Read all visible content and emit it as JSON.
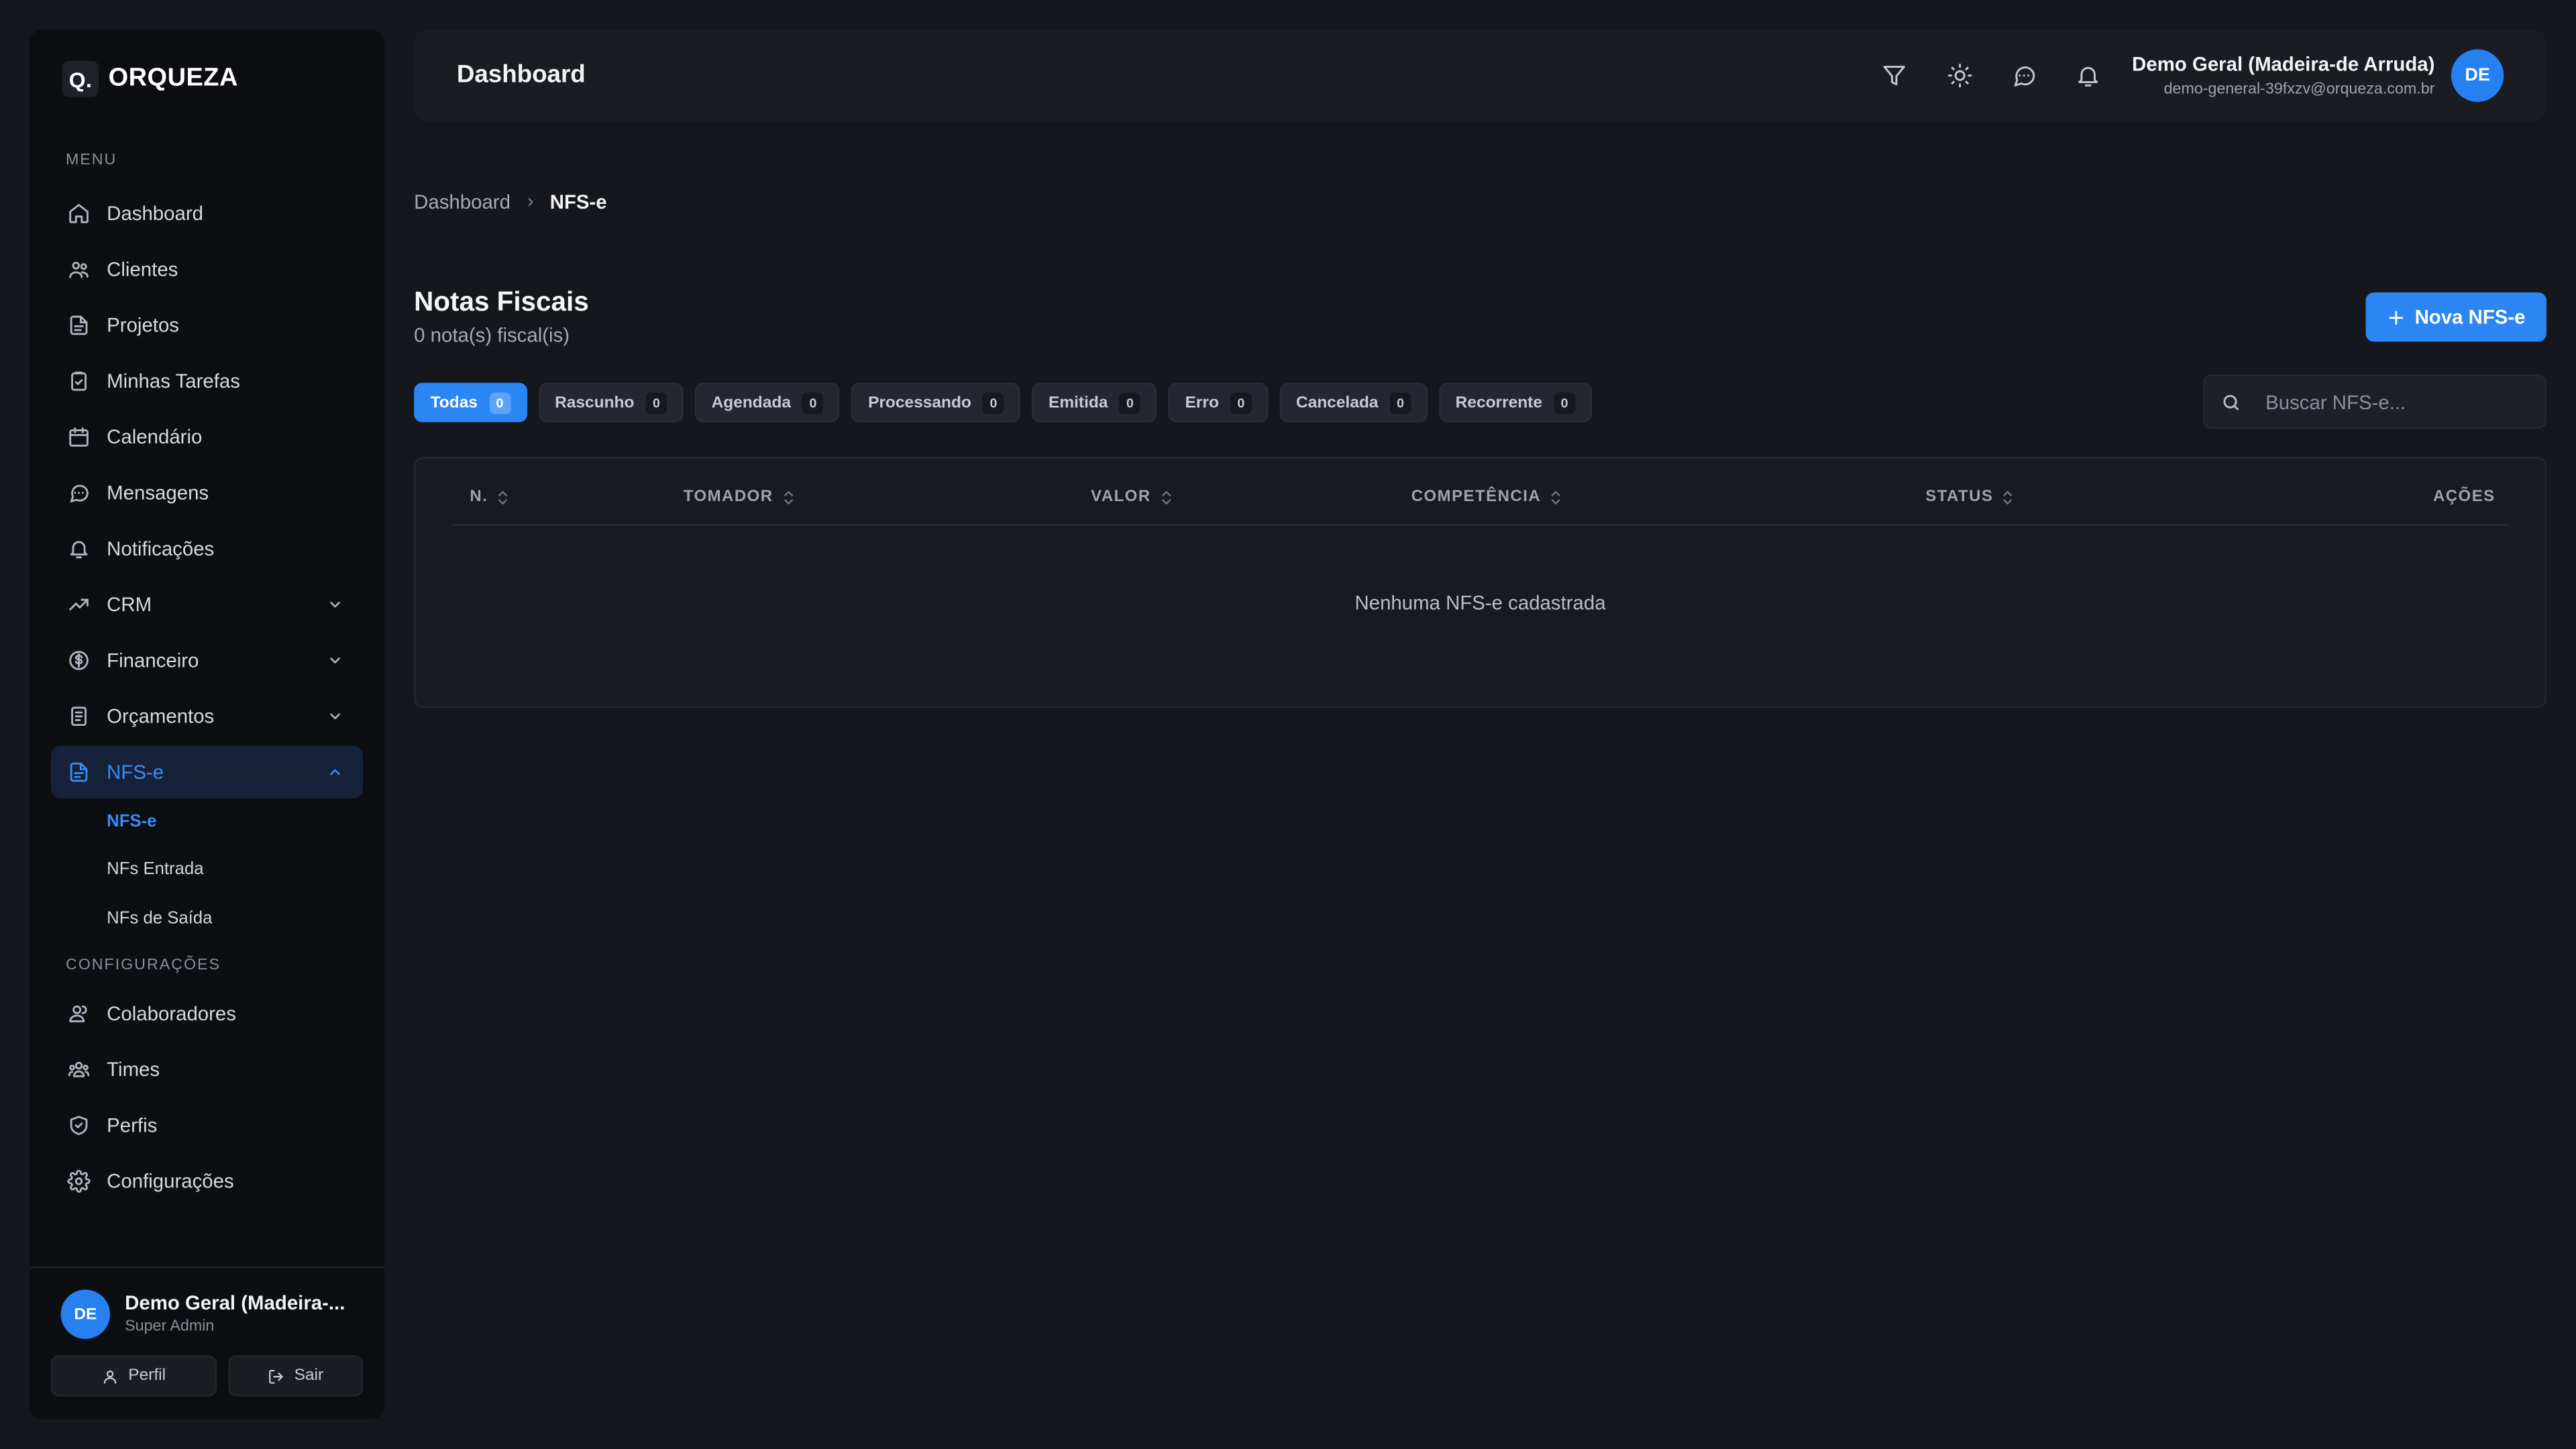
{
  "app": {
    "logo_mark": "Q.",
    "logo_text": "ORQUEZA"
  },
  "sidebar": {
    "menu_label": "MENU",
    "items": [
      {
        "label": "Dashboard",
        "icon": "home-icon"
      },
      {
        "label": "Clientes",
        "icon": "users-icon"
      },
      {
        "label": "Projetos",
        "icon": "file-icon"
      },
      {
        "label": "Minhas Tarefas",
        "icon": "clipboard-check-icon"
      },
      {
        "label": "Calendário",
        "icon": "calendar-icon"
      },
      {
        "label": "Mensagens",
        "icon": "message-icon"
      },
      {
        "label": "Notificações",
        "icon": "bell-icon"
      },
      {
        "label": "CRM",
        "icon": "trending-up-icon"
      },
      {
        "label": "Financeiro",
        "icon": "dollar-circle-icon"
      },
      {
        "label": "Orçamentos",
        "icon": "receipt-icon"
      },
      {
        "label": "NFS-e",
        "icon": "file-text-icon"
      }
    ],
    "nfse_sub": [
      "NFS-e",
      "NFs Entrada",
      "NFs de Saída"
    ],
    "config_label": "CONFIGURAÇÕES",
    "config_items": [
      {
        "label": "Colaboradores",
        "icon": "user-group-icon"
      },
      {
        "label": "Times",
        "icon": "team-icon"
      },
      {
        "label": "Perfis",
        "icon": "shield-icon"
      },
      {
        "label": "Configurações",
        "icon": "gear-icon"
      }
    ],
    "footer": {
      "avatar_initials": "DE",
      "name": "Demo Geral (Madeira-...",
      "role": "Super Admin",
      "profile_button": "Perfil",
      "logout_button": "Sair"
    }
  },
  "header": {
    "title": "Dashboard",
    "user_name": "Demo Geral (Madeira-de Arruda)",
    "user_email": "demo-general-39fxzv@orqueza.com.br",
    "avatar_initials": "DE"
  },
  "breadcrumb": {
    "parent": "Dashboard",
    "current": "NFS-e"
  },
  "page": {
    "title": "Notas Fiscais",
    "subtitle": "0 nota(s) fiscal(is)",
    "new_button": "Nova NFS-e"
  },
  "filters": [
    {
      "label": "Todas",
      "count": "0",
      "active": true
    },
    {
      "label": "Rascunho",
      "count": "0"
    },
    {
      "label": "Agendada",
      "count": "0"
    },
    {
      "label": "Processando",
      "count": "0"
    },
    {
      "label": "Emitida",
      "count": "0"
    },
    {
      "label": "Erro",
      "count": "0"
    },
    {
      "label": "Cancelada",
      "count": "0"
    },
    {
      "label": "Recorrente",
      "count": "0"
    }
  ],
  "search": {
    "placeholder": "Buscar NFS-e...",
    "value": ""
  },
  "table": {
    "columns": [
      "N.",
      "TOMADOR",
      "VALOR",
      "COMPETÊNCIA",
      "STATUS",
      "AÇÕES"
    ],
    "empty_text": "Nenhuma NFS-e cadastrada"
  },
  "colors": {
    "accent": "#2b86f3",
    "background": "#16171c",
    "sidebar": "#0d0e12"
  }
}
